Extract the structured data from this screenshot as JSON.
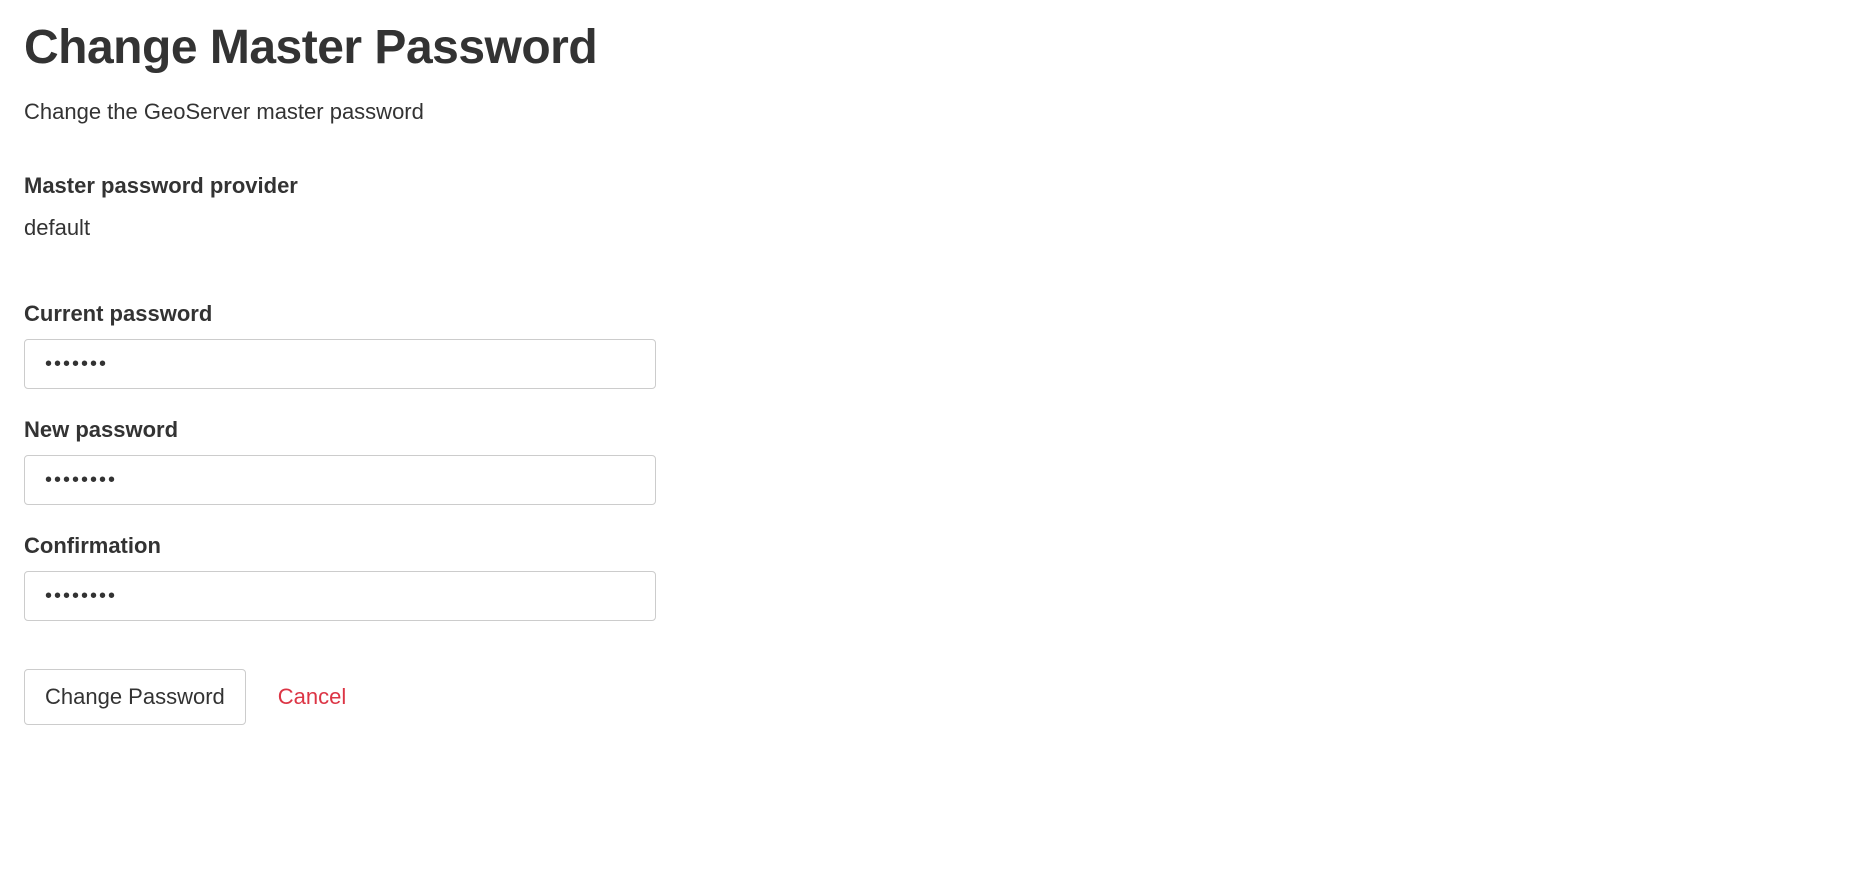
{
  "page": {
    "title": "Change Master Password",
    "description": "Change the GeoServer master password"
  },
  "provider": {
    "label": "Master password provider",
    "value": "default"
  },
  "fields": {
    "current": {
      "label": "Current password",
      "value": "•••••••"
    },
    "new": {
      "label": "New password",
      "value": "••••••••"
    },
    "confirm": {
      "label": "Confirmation",
      "value": "••••••••"
    }
  },
  "actions": {
    "submit": "Change Password",
    "cancel": "Cancel"
  }
}
